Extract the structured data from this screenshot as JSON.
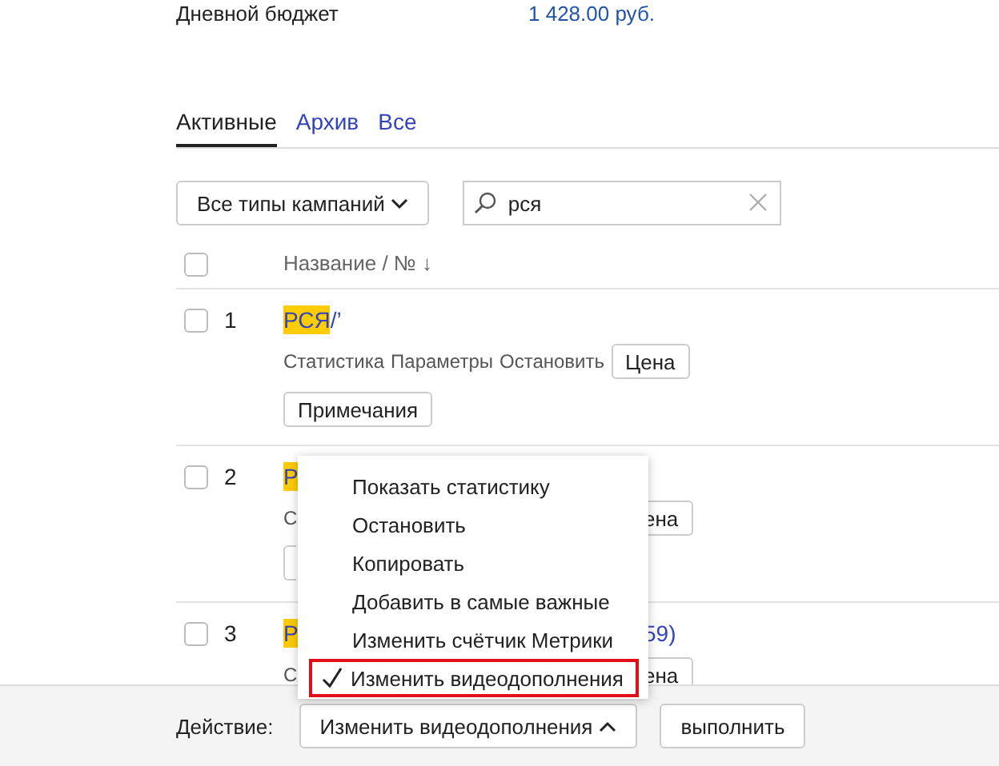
{
  "budget": {
    "label": "Дневной бюджет",
    "value": "1 428.00 руб."
  },
  "tabs": [
    {
      "label": "Активные",
      "selected": true
    },
    {
      "label": "Архив",
      "selected": false
    },
    {
      "label": "Все",
      "selected": false
    }
  ],
  "filter": {
    "value": "Все типы кампаний"
  },
  "search": {
    "value": "рся"
  },
  "table": {
    "header": {
      "checked": false,
      "label": "Название / № ↓"
    },
    "rows": [
      {
        "kind": "full",
        "checked": false,
        "number": "1",
        "title_match": "РСЯ",
        "title_rest": "/’",
        "links": [
          "Статистика",
          "Параметры",
          "Остановить"
        ],
        "price_button": "Цена",
        "notes_button": "Примечания"
      },
      {
        "kind": "covered",
        "checked": false,
        "number": "2",
        "title_match": "Р",
        "links_start": "С",
        "price_button": "ена",
        "notes_edge": true
      },
      {
        "kind": "covered",
        "checked": false,
        "number": "3",
        "title_match": "Р",
        "title_tail": "59)",
        "links_start": "С",
        "price_button": "ена"
      }
    ]
  },
  "menu": {
    "items": [
      {
        "label": "Показать статистику",
        "selected": false
      },
      {
        "label": "Остановить",
        "selected": false
      },
      {
        "label": "Копировать",
        "selected": false
      },
      {
        "label": "Добавить в самые важные",
        "selected": false
      },
      {
        "label": "Изменить счётчик Метрики",
        "selected": false
      },
      {
        "label": "Изменить видеодополнения",
        "selected": true
      }
    ]
  },
  "action_bar": {
    "label": "Действие:",
    "select": {
      "value": "Изменить видеодополнения",
      "expanded": true
    },
    "button": "выполнить"
  }
}
